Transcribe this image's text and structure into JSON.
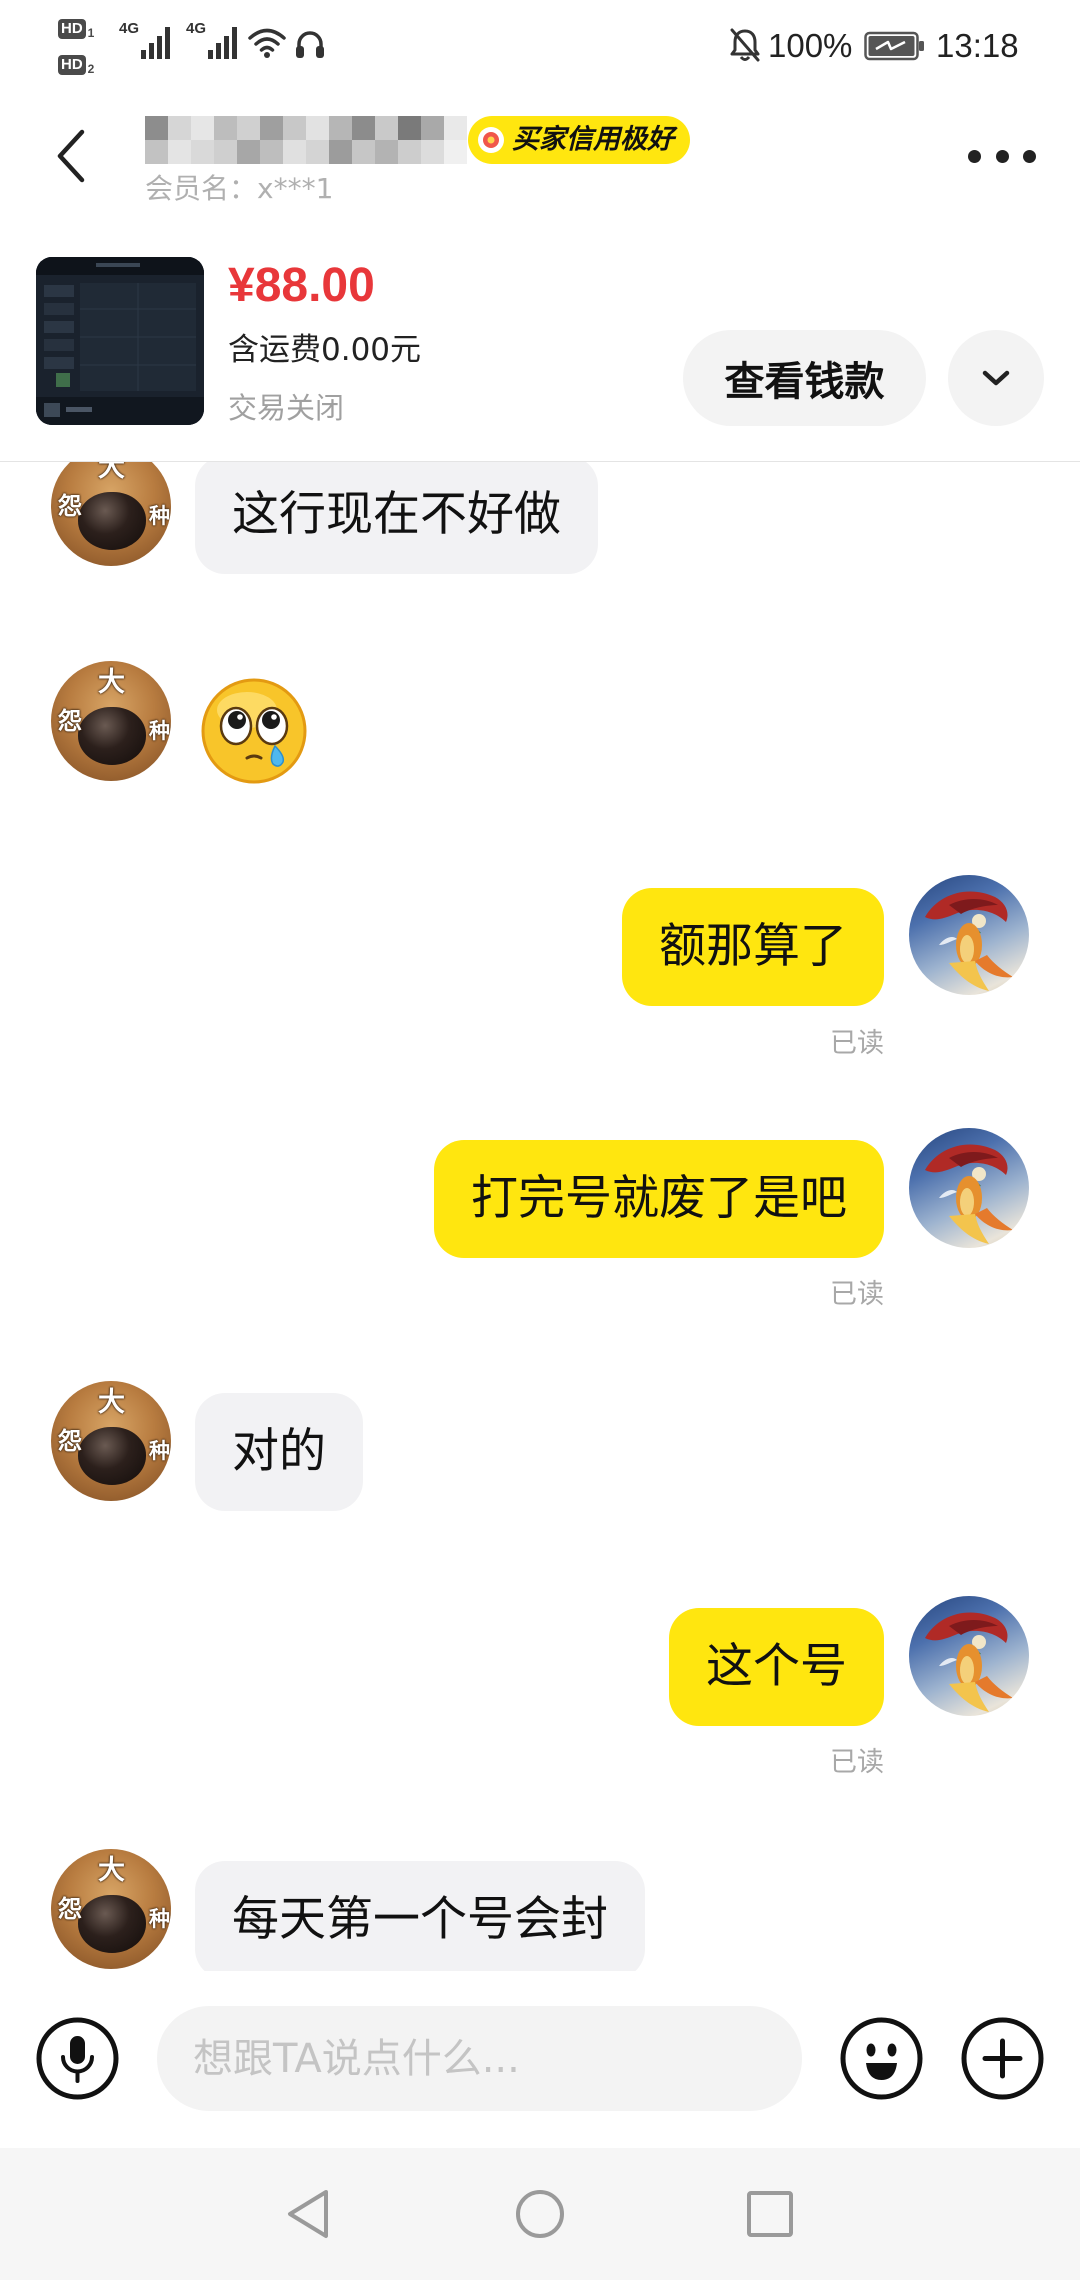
{
  "status_bar": {
    "sim1": {
      "label": "HD",
      "index": "1"
    },
    "sim2": {
      "label": "HD",
      "index": "2"
    },
    "network1": "4G",
    "network2": "4G",
    "battery_percent": "100%",
    "battery_level": 1.0,
    "time": "13:18",
    "icons": [
      "signal-icon",
      "wifi-icon",
      "headphones-icon",
      "bell-off-icon",
      "battery-icon"
    ]
  },
  "header": {
    "back_icon": "back-arrow-icon",
    "credit_badge": "买家信用极好",
    "member_name": "会员名：x***1",
    "more_icon": "more-icon"
  },
  "product": {
    "price": "¥88.00",
    "shipping": "含运费0.00元",
    "status": "交易关闭",
    "view_payment_button": "查看钱款",
    "expand_icon": "chevron-down-icon"
  },
  "contact_avatar": {
    "top_char": "大",
    "left_char": "怨",
    "right_char": "种"
  },
  "messages": [
    {
      "outgoing": false,
      "text": "这行现在不好做"
    },
    {
      "outgoing": false,
      "sticker": "crying-face-emoji"
    },
    {
      "outgoing": true,
      "text": "额那算了",
      "status": "已读"
    },
    {
      "outgoing": true,
      "text": "打完号就废了是吧",
      "status": "已读"
    },
    {
      "outgoing": false,
      "text": "对的"
    },
    {
      "outgoing": true,
      "text": "这个号",
      "status": "已读"
    },
    {
      "outgoing": false,
      "text": "每天第一个号会封"
    }
  ],
  "input": {
    "placeholder": "想跟TA说点什么...",
    "voice_icon": "microphone-icon",
    "emoji_icon": "emoji-icon",
    "attach_icon": "plus-icon"
  },
  "nav_bar": {
    "icons": [
      "back-triangle-icon",
      "home-circle-icon",
      "recents-square-icon"
    ]
  },
  "colors": {
    "accent_yellow": "#FFE60F",
    "price_red": "#E8373A",
    "incoming_bubble": "#F2F2F4",
    "text": "#111111"
  }
}
